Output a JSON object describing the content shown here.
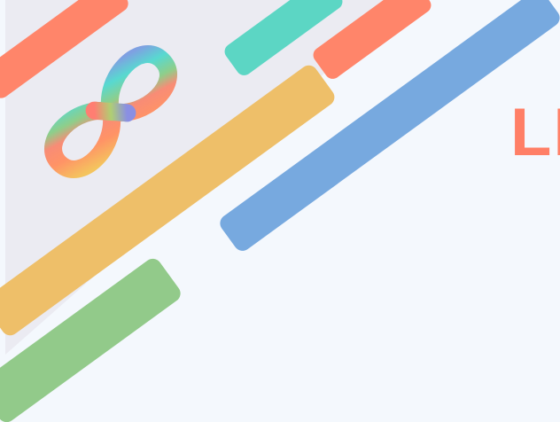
{
  "hero": {
    "headline": "LE"
  },
  "colors": {
    "page_background": "#f4f8fd",
    "gray_band": "#ebebf2",
    "stripe_coral": "#ff856a",
    "stripe_teal": "#5cd6c4",
    "stripe_yellow": "#eebf69",
    "stripe_blue": "#77a9df",
    "stripe_green": "#92ca8a",
    "headline": "#ff7f66",
    "infinity_gradient": [
      "#ff7d6b",
      "#f3cc62",
      "#6dcf8f",
      "#58d8d2",
      "#8c93e0",
      "#ff7d6b"
    ]
  },
  "icons": {
    "logo": "infinity-rainbow-logo"
  }
}
